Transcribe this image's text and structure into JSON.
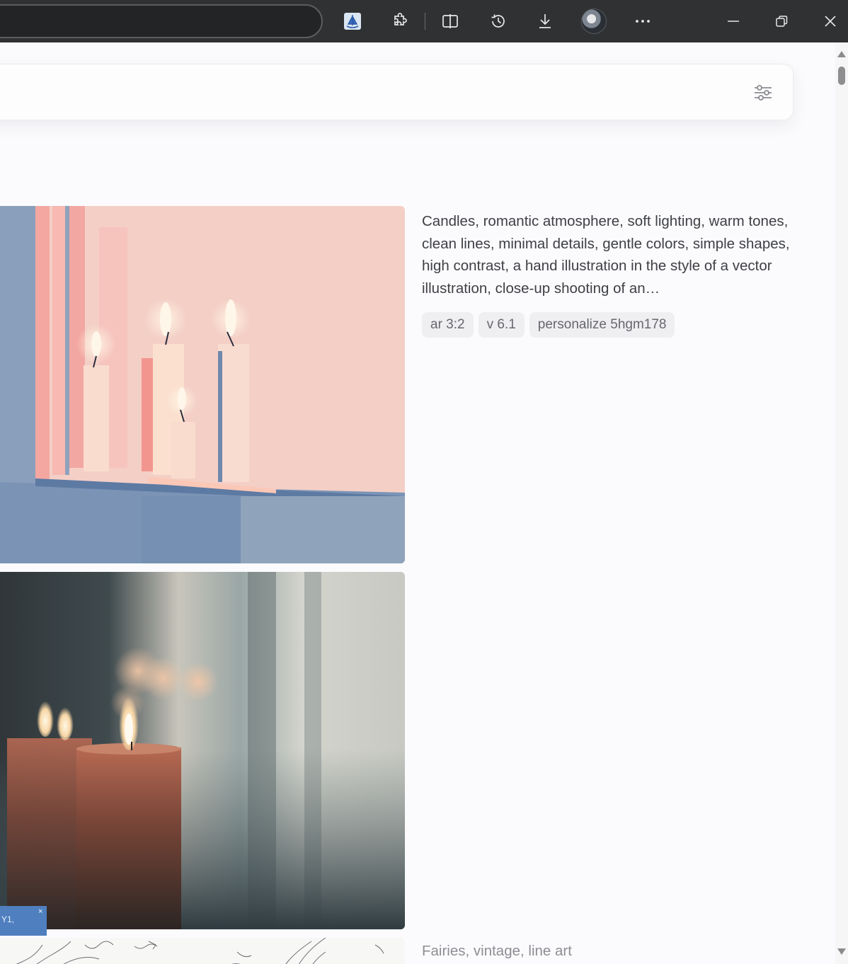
{
  "browser": {
    "toolbar_icons": [
      "extension-app-icon",
      "puzzle-icon",
      "split-screen-icon",
      "history-icon",
      "download-icon",
      "profile-avatar",
      "more-icon"
    ],
    "window_controls": [
      "minimize-icon",
      "restore-icon",
      "close-icon"
    ]
  },
  "search": {
    "filter_icon": "sliders-icon"
  },
  "results": [
    {
      "prompt": "Candles, romantic atmosphere, soft lighting, warm tones, clean lines, minimal details, gentle colors, simple shapes, high contrast, a hand illustration in the style of a vector illustration, close-up shooting of an…",
      "tags": [
        "ar 3:2",
        "v 6.1",
        "personalize 5hgm178"
      ]
    },
    {
      "prompt": "Fairies, vintage, line art"
    }
  ],
  "overlay_chip": {
    "text": "Y1,",
    "close": "×"
  },
  "colors": {
    "titlebar": "#2f3133",
    "page_bg": "#fbfbfd",
    "tag_bg": "#efeff2",
    "chip_bg": "#4f7fbf"
  }
}
